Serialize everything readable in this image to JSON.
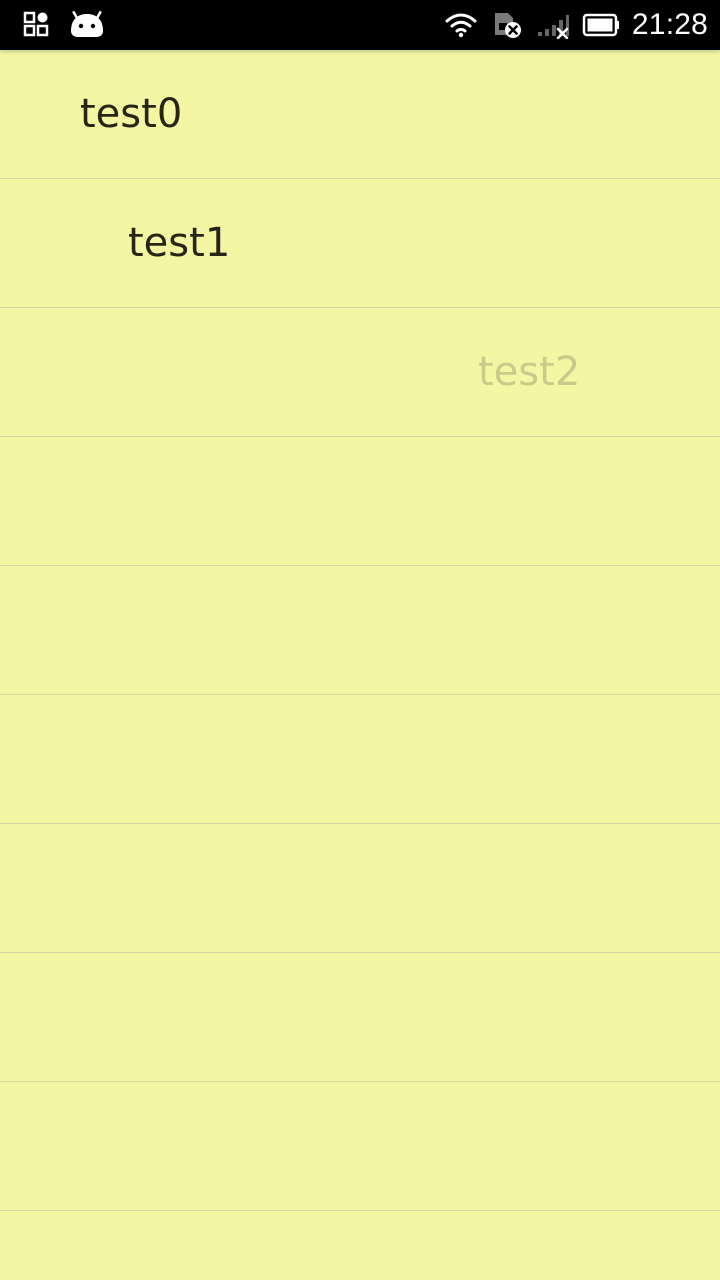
{
  "status_bar": {
    "time": "21:28",
    "icons": [
      "qr-code-icon",
      "android-icon",
      "wifi-icon",
      "sim-card-blocked-icon",
      "no-signal-icon",
      "battery-icon"
    ]
  },
  "list": {
    "items": [
      {
        "label": "test0",
        "faded": false
      },
      {
        "label": "test1",
        "faded": false
      },
      {
        "label": "test2",
        "faded": true
      },
      {
        "label": ""
      },
      {
        "label": ""
      },
      {
        "label": ""
      },
      {
        "label": ""
      },
      {
        "label": ""
      },
      {
        "label": ""
      },
      {
        "label": ""
      }
    ]
  },
  "colors": {
    "background": "#f4f6a3",
    "divider": "#d6d7a6",
    "text": "#262616",
    "faded_text": "#cacb8a",
    "status_bar": "#000000"
  }
}
